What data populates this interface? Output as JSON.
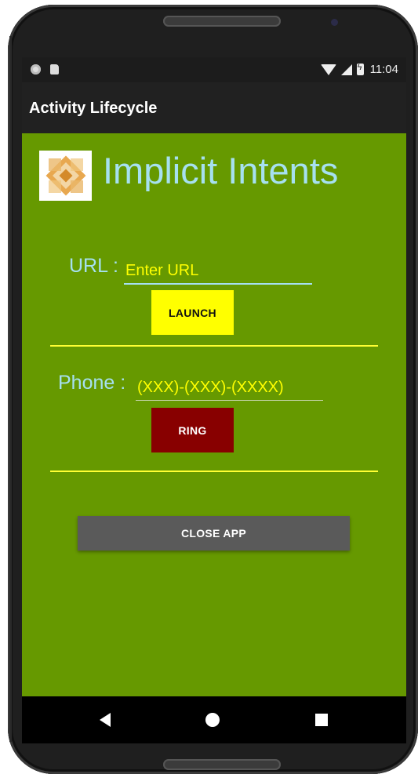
{
  "status_bar": {
    "time": "11:04"
  },
  "app_bar": {
    "title": "Activity Lifecycle"
  },
  "main": {
    "heading": "Implicit Intents",
    "url_label": "URL :",
    "url_placeholder": "Enter URL",
    "launch_label": "LAUNCH",
    "phone_label": "Phone :",
    "phone_placeholder": "(XXX)-(XXX)-(XXXX)",
    "ring_label": "RING",
    "close_label": "CLOSE APP"
  },
  "colors": {
    "background": "#669900",
    "accent_text": "#a6e0f0",
    "hint_text": "#ffff00",
    "launch_button": "#ffff00",
    "ring_button": "#880000",
    "close_button": "#5a5a5a",
    "divider": "#ffff33"
  },
  "icons": {
    "logo": "diamond-logo-icon",
    "nav_back": "back-triangle-icon",
    "nav_home": "home-circle-icon",
    "nav_recent": "recents-square-icon"
  }
}
